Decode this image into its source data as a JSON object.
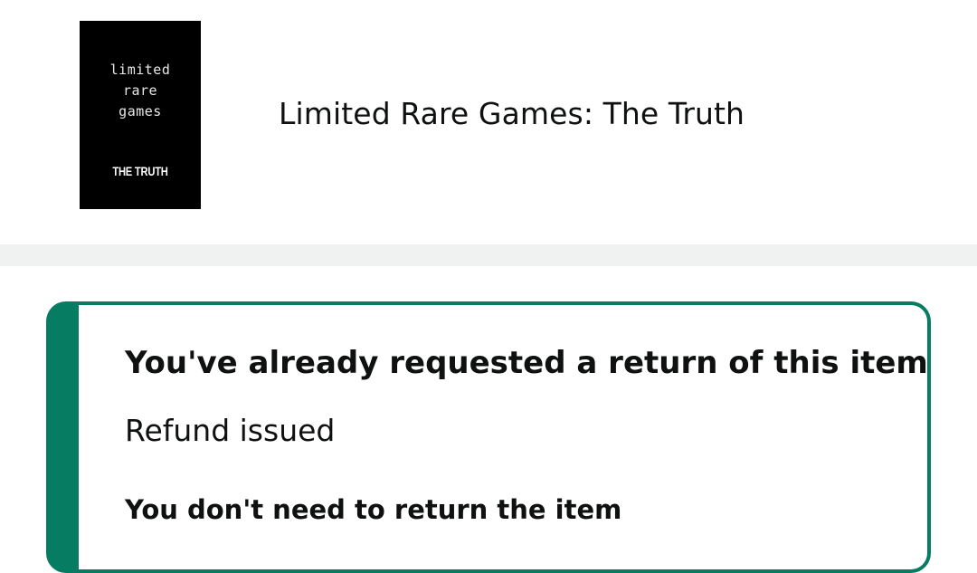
{
  "product": {
    "cover": {
      "line1": "limited",
      "line2": "rare",
      "line3": "games",
      "subtitle": "THE TRUTH"
    },
    "title": "Limited Rare Games: The Truth"
  },
  "return_status": {
    "heading": "You've already requested a return of this item",
    "status": "Refund issued",
    "note": "You don't need to return the item",
    "accent_color": "#067d62"
  },
  "colors": {
    "divider": "#f0f2f2",
    "text": "#0f1111",
    "cover_background": "#000000"
  }
}
